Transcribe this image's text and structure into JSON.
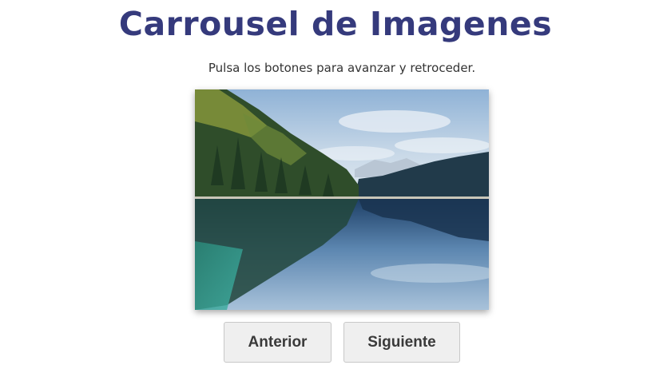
{
  "page": {
    "title": "Carrousel de Imagenes",
    "subtitle": "Pulsa los botones para avanzar y retroceder."
  },
  "carousel": {
    "image_alt": "mountain-lake-reflection-image"
  },
  "buttons": {
    "prev_label": "Anterior",
    "next_label": "Siguiente"
  },
  "colors": {
    "title": "#353a7c",
    "button_bg": "#efefef"
  }
}
